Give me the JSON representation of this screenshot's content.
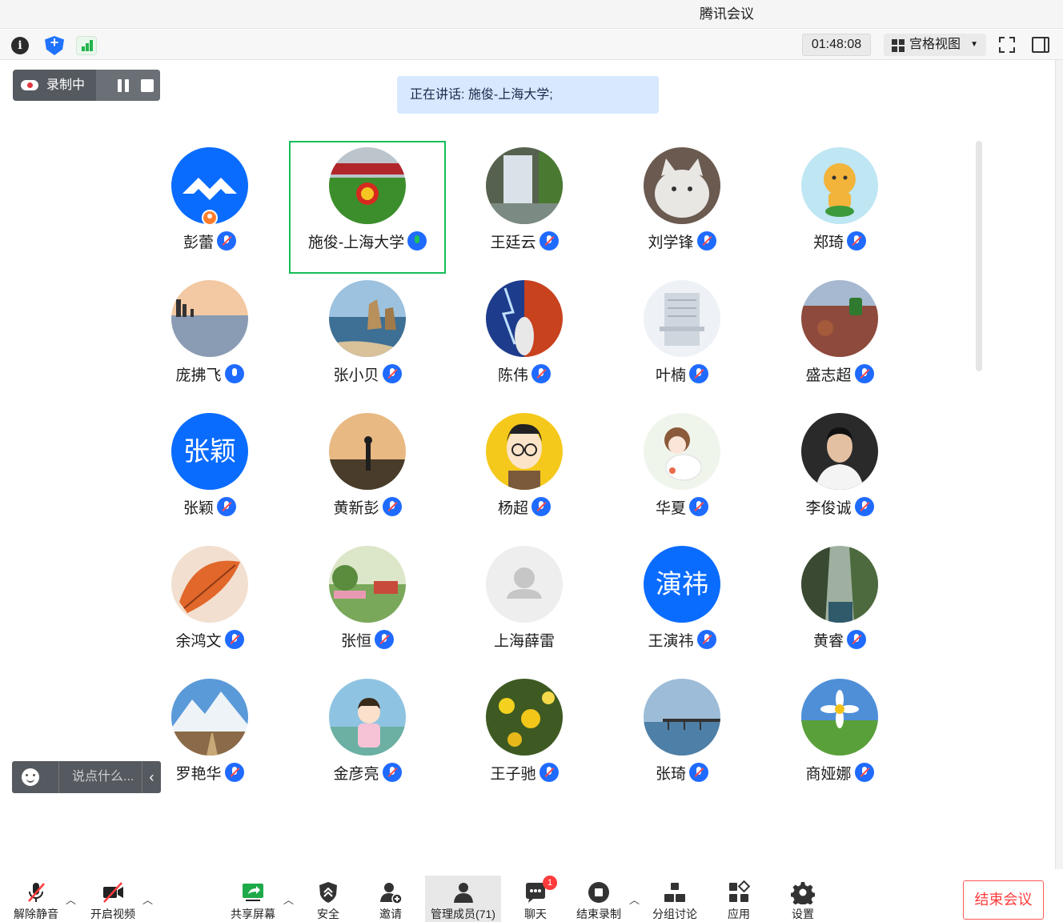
{
  "window": {
    "title": "腾讯会议"
  },
  "toolbar": {
    "timer": "01:48:08",
    "view_label": "宫格视图",
    "icons": [
      "info-icon",
      "security-shield-icon",
      "network-signal-icon",
      "fullscreen-icon",
      "side-panel-icon"
    ]
  },
  "recording": {
    "label": "录制中"
  },
  "speaking": {
    "text": "正在讲话: 施俊-上海大学;"
  },
  "participants": [
    {
      "name": "彭蕾",
      "mic": "muted",
      "avatar": "logo",
      "host": true,
      "color": "#0a6cff"
    },
    {
      "name": "施俊-上海大学",
      "mic": "talking",
      "avatar": "stadium",
      "active": true,
      "color": "#3a8a3a"
    },
    {
      "name": "王廷云",
      "mic": "muted",
      "avatar": "waterfall",
      "color": "#6f7a68"
    },
    {
      "name": "刘学锋",
      "mic": "muted",
      "avatar": "cat",
      "color": "#8f8a86"
    },
    {
      "name": "郑琦",
      "mic": "muted",
      "avatar": "cartoon-dog",
      "color": "#bfe6f3"
    },
    {
      "name": "庞拂飞",
      "mic": "unmuted",
      "avatar": "sunset-beach",
      "color": "#9aa5b6"
    },
    {
      "name": "张小贝",
      "mic": "muted",
      "avatar": "sea-rocks",
      "color": "#6a8fb0"
    },
    {
      "name": "陈伟",
      "mic": "muted",
      "avatar": "fire-ice",
      "color": "#a34a3a"
    },
    {
      "name": "叶楠",
      "mic": "muted",
      "avatar": "building",
      "color": "#d9dfe6"
    },
    {
      "name": "盛志超",
      "mic": "muted",
      "avatar": "field",
      "color": "#8a5a48"
    },
    {
      "name": "张颖",
      "mic": "muted",
      "avatar": "text",
      "avatar_text": "张颖",
      "color": "#0a6cff"
    },
    {
      "name": "黄新彭",
      "mic": "muted",
      "avatar": "golfer",
      "color": "#8a6a48"
    },
    {
      "name": "杨超",
      "mic": "muted",
      "avatar": "cartoon-man",
      "color": "#f2c81a"
    },
    {
      "name": "华夏",
      "mic": "muted",
      "avatar": "cartoon-girl",
      "color": "#e8efe4"
    },
    {
      "name": "李俊诚",
      "mic": "muted",
      "avatar": "portrait",
      "color": "#3c3c3c"
    },
    {
      "name": "余鸿文",
      "mic": "muted",
      "avatar": "leaf",
      "color": "#d9652a"
    },
    {
      "name": "张恒",
      "mic": "muted",
      "avatar": "garden",
      "color": "#9bbf8a"
    },
    {
      "name": "上海薛雷",
      "mic": "none",
      "avatar": "default-user",
      "color": "#e6e6e6"
    },
    {
      "name": "王演祎",
      "mic": "muted",
      "avatar": "text",
      "avatar_text": "演祎",
      "color": "#0a6cff"
    },
    {
      "name": "黄睿",
      "mic": "muted",
      "avatar": "canyon",
      "color": "#5e7a54"
    },
    {
      "name": "罗艳华",
      "mic": "muted",
      "avatar": "mountains",
      "color": "#4d7fb8"
    },
    {
      "name": "金彦亮",
      "mic": "muted",
      "avatar": "child",
      "color": "#7fb5d9"
    },
    {
      "name": "王子驰",
      "mic": "muted",
      "avatar": "flowers",
      "color": "#5a7a2a"
    },
    {
      "name": "张琦",
      "mic": "muted",
      "avatar": "pier",
      "color": "#86a8c8"
    },
    {
      "name": "商娅娜",
      "mic": "muted",
      "avatar": "daisy",
      "color": "#5f9e3e"
    }
  ],
  "chat": {
    "placeholder": "说点什么..."
  },
  "bottom": {
    "unmute": "解除静音",
    "video": "开启视频",
    "share": "共享屏幕",
    "security": "安全",
    "invite": "邀请",
    "members": "管理成员(71)",
    "chat": "聊天",
    "chat_badge": "1",
    "stop_record": "结束录制",
    "breakout": "分组讨论",
    "apps": "应用",
    "settings": "设置",
    "end_meeting": "结束会议"
  }
}
